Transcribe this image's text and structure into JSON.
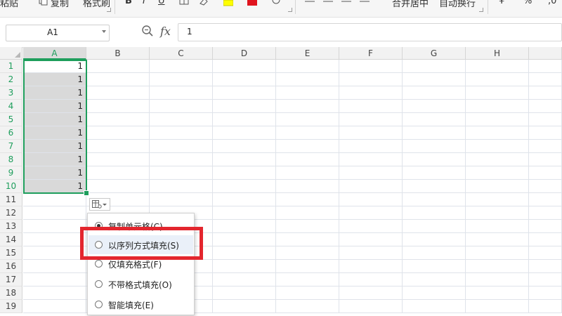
{
  "toolbar": {
    "paste_label": "粘贴",
    "copy_label": "复制",
    "format_painter_label": "格式刷",
    "merge_center_label": "合并居中",
    "wrap_text_label": "自动换行",
    "icons": [
      "paste-icon",
      "copy-icon",
      "bold-icon",
      "italic-icon",
      "underline-icon",
      "border-icon",
      "eraser-icon",
      "fill-color-icon",
      "font-color-icon",
      "clear-icon",
      "align-top-icon",
      "align-middle-icon",
      "align-bottom-icon",
      "align-left-icon",
      "currency-icon",
      "percent-icon",
      "thousands-icon"
    ],
    "colors": {
      "fill_color": "#ffff00",
      "font_color": "#e0141e"
    }
  },
  "formula_bar": {
    "name_box_value": "A1",
    "fx_label": "fx",
    "formula_value": "1"
  },
  "sheet": {
    "columns": [
      "A",
      "B",
      "C",
      "D",
      "E",
      "F",
      "G",
      "H"
    ],
    "selected_column": "A",
    "rows": [
      1,
      2,
      3,
      4,
      5,
      6,
      7,
      8,
      9,
      10,
      11,
      12,
      13,
      14,
      15,
      16,
      17,
      18,
      19
    ],
    "column_a_values": [
      "1",
      "1",
      "1",
      "1",
      "1",
      "1",
      "1",
      "1",
      "1",
      "1"
    ],
    "selection_range": "A1:A10",
    "selection_color": "#1e9e5c"
  },
  "autofill_menu": {
    "options": [
      {
        "label": "复制单元格(C)",
        "checked": true
      },
      {
        "label": "以序列方式填充(S)",
        "checked": false
      },
      {
        "label": "仅填充格式(F)",
        "checked": false
      },
      {
        "label": "不带格式填充(O)",
        "checked": false
      },
      {
        "label": "智能填充(E)",
        "checked": false
      }
    ],
    "highlighted_option": 1,
    "highlight_color": "#e3262e"
  }
}
